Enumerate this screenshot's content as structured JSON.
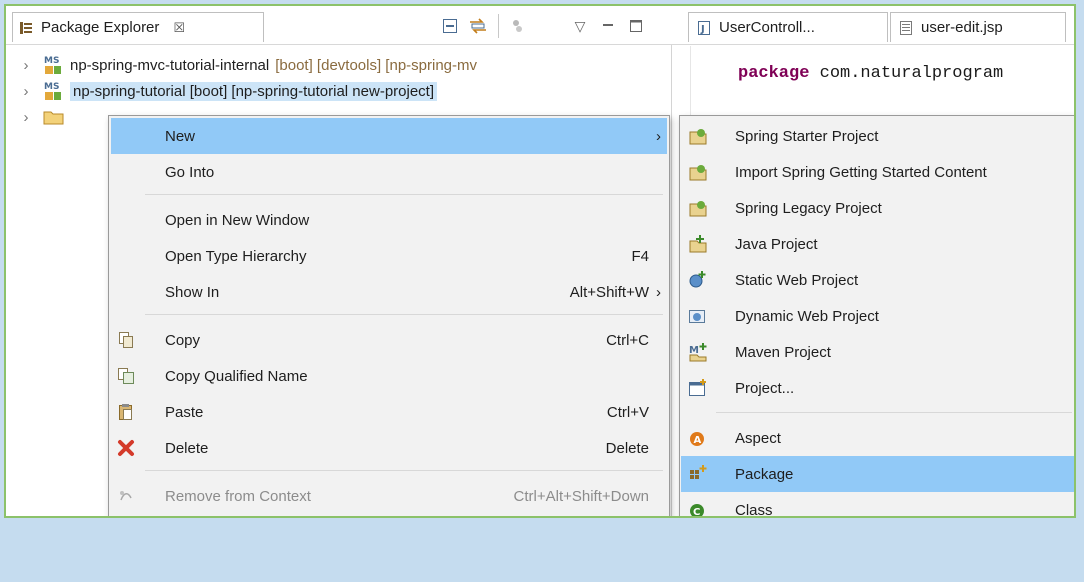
{
  "view": {
    "title": "Package Explorer",
    "close_glyph": "☒",
    "toolbar_icons": [
      "collapse-all-icon",
      "link-with-editor-icon",
      "focus-icon",
      "view-menu-icon",
      "minimize-icon",
      "maximize-icon"
    ]
  },
  "tree": [
    {
      "name": "np-spring-mvc-tutorial-internal",
      "decoration": "[boot] [devtools] [np-spring-mv",
      "selected": false
    },
    {
      "name": "np-spring-tutorial [boot]  [np-spring-tutorial new-project]",
      "decoration": "",
      "selected": true
    }
  ],
  "editor": {
    "tabs": [
      {
        "label": "UserControll...",
        "icon": "java-file-icon"
      },
      {
        "label": "user-edit.jsp",
        "icon": "jsp-file-icon"
      }
    ],
    "keyword": "package",
    "code_rest": " com.naturalprogram"
  },
  "menu": {
    "items": [
      {
        "label": "New",
        "shortcut": "",
        "submenu": true,
        "icon": "",
        "highlighted": true,
        "disabled": false
      },
      {
        "label": "Go Into",
        "shortcut": "",
        "submenu": false,
        "icon": "",
        "highlighted": false,
        "disabled": false
      },
      {
        "label": "Open in New Window",
        "shortcut": "",
        "submenu": false,
        "icon": "",
        "highlighted": false,
        "disabled": false
      },
      {
        "label": "Open Type Hierarchy",
        "shortcut": "F4",
        "submenu": false,
        "icon": "",
        "highlighted": false,
        "disabled": false
      },
      {
        "label": "Show In",
        "shortcut": "Alt+Shift+W",
        "submenu": true,
        "icon": "",
        "highlighted": false,
        "disabled": false
      },
      {
        "label": "Copy",
        "shortcut": "Ctrl+C",
        "submenu": false,
        "icon": "copy-icon",
        "highlighted": false,
        "disabled": false
      },
      {
        "label": "Copy Qualified Name",
        "shortcut": "",
        "submenu": false,
        "icon": "copy-qualified-name-icon",
        "highlighted": false,
        "disabled": false
      },
      {
        "label": "Paste",
        "shortcut": "Ctrl+V",
        "submenu": false,
        "icon": "paste-icon",
        "highlighted": false,
        "disabled": false
      },
      {
        "label": "Delete",
        "shortcut": "Delete",
        "submenu": false,
        "icon": "delete-icon",
        "highlighted": false,
        "disabled": false
      },
      {
        "label": "Remove from Context",
        "shortcut": "Ctrl+Alt+Shift+Down",
        "submenu": false,
        "icon": "remove-context-icon",
        "highlighted": false,
        "disabled": true
      }
    ]
  },
  "submenu": {
    "items": [
      {
        "label": "Spring Starter Project",
        "icon": "spring-project-icon",
        "highlighted": false
      },
      {
        "label": "Import Spring Getting Started Content",
        "icon": "spring-import-icon",
        "highlighted": false
      },
      {
        "label": "Spring Legacy Project",
        "icon": "spring-legacy-icon",
        "highlighted": false
      },
      {
        "label": "Java Project",
        "icon": "java-project-icon",
        "highlighted": false
      },
      {
        "label": "Static Web Project",
        "icon": "static-web-icon",
        "highlighted": false
      },
      {
        "label": "Dynamic Web Project",
        "icon": "dynamic-web-icon",
        "highlighted": false
      },
      {
        "label": "Maven Project",
        "icon": "maven-icon",
        "highlighted": false
      },
      {
        "label": "Project...",
        "icon": "project-icon",
        "highlighted": false
      },
      {
        "label": "Aspect",
        "icon": "aspect-icon",
        "highlighted": false
      },
      {
        "label": "Package",
        "icon": "package-icon",
        "highlighted": true
      },
      {
        "label": "Class",
        "icon": "class-icon",
        "highlighted": false
      }
    ]
  },
  "colors": {
    "highlight": "#91c9f7",
    "selection": "#cce4f7",
    "border_accent": "#8cc26a",
    "background": "#c5dcef"
  }
}
